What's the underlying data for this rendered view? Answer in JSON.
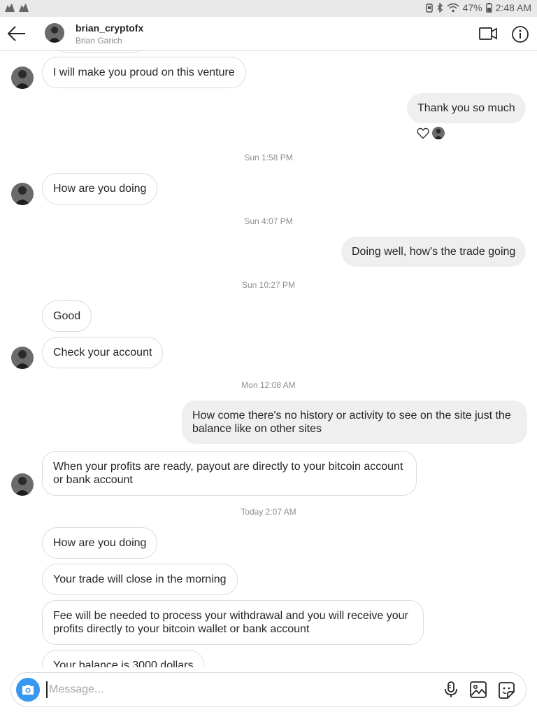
{
  "status_bar": {
    "battery": "47%",
    "time": "2:48 AM"
  },
  "header": {
    "username": "brian_cryptofx",
    "full_name": "Brian Garich"
  },
  "messages": [
    {
      "text": "I will make you proud on this venture"
    },
    {
      "text": "Thank you so much"
    },
    {
      "text": "How are you doing"
    },
    {
      "text": "Doing well, how's the trade going"
    },
    {
      "text": "Good"
    },
    {
      "text": "Check your account"
    },
    {
      "text": "How come there's no history or activity to see on the site just the balance like on other sites"
    },
    {
      "text": "When your profits are ready, payout are directly to your bitcoin account or bank account"
    },
    {
      "text": "How are you doing"
    },
    {
      "text": "Your trade will close in the morning"
    },
    {
      "text": "Fee will be needed to process your withdrawal and you will receive your profits directly to your bitcoin wallet or bank account"
    },
    {
      "text": "Your balance is 3000 dollars"
    }
  ],
  "timestamps": [
    "Sun 1:58 PM",
    "Sun 4:07 PM",
    "Sun 10:27 PM",
    "Mon 12:08 AM",
    "Today 2:07 AM"
  ],
  "composer": {
    "placeholder": "Message..."
  },
  "icons": {
    "back": "back-arrow-icon",
    "video": "video-call-icon",
    "info": "info-icon",
    "camera": "camera-icon",
    "mic": "microphone-icon",
    "gallery": "gallery-icon",
    "sticker": "sticker-icon",
    "heart": "heart-icon"
  },
  "colors": {
    "accent": "#3897f0",
    "outgoing_bubble": "#efefef",
    "border": "#dbdbdb",
    "secondary_text": "#8e8e8e"
  }
}
